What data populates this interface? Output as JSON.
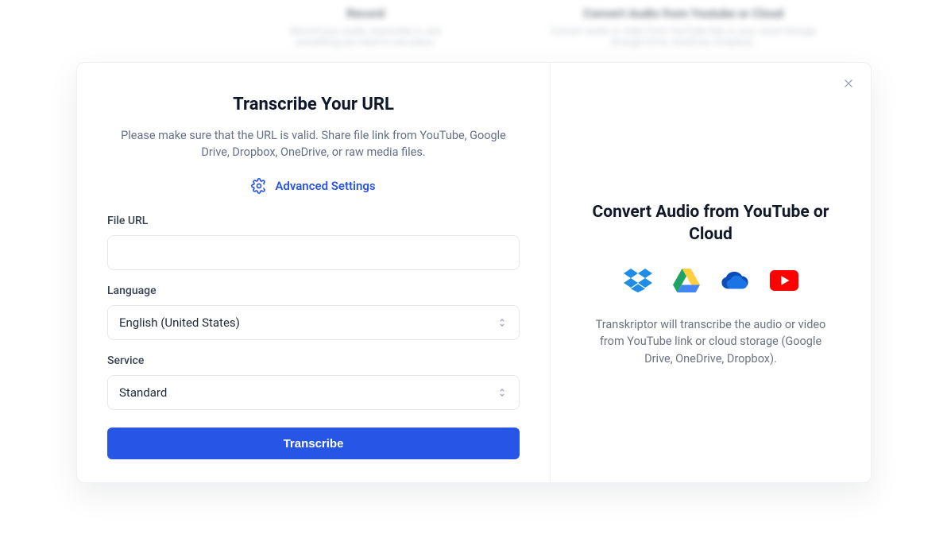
{
  "background": {
    "card_middle": {
      "title": "Record",
      "sub": "Record your audio, transcribe it, and everything you need in one place."
    },
    "card_right": {
      "title": "Convert Audio from Youtube or Cloud",
      "sub": "Convert audio or video from YouTube link or your cloud storage (Google Drive, OneDrive, Dropbox)."
    }
  },
  "modal": {
    "title": "Transcribe Your URL",
    "description": "Please make sure that the URL is valid. Share file link from YouTube, Google Drive, Dropbox, OneDrive, or raw media files.",
    "advanced_settings": "Advanced Settings",
    "fields": {
      "file_url_label": "File URL",
      "file_url_value": "",
      "language_label": "Language",
      "language_value": "English (United States)",
      "service_label": "Service",
      "service_value": "Standard"
    },
    "submit_label": "Transcribe"
  },
  "right": {
    "title": "Convert Audio from YouTube or Cloud",
    "description": "Transkriptor will transcribe the audio or video from YouTube link or cloud storage (Google Drive, OneDrive, Dropbox)."
  }
}
